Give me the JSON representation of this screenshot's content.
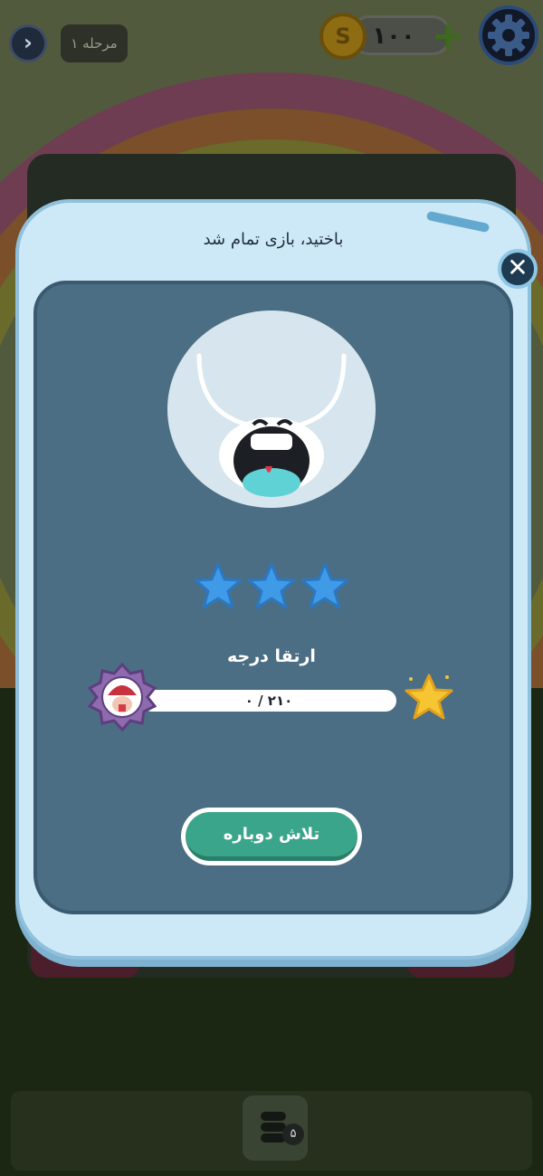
{
  "topbar": {
    "back_icon": "chevron-right-icon",
    "level_label": "مرحله ۱",
    "coins": "۱۰۰",
    "coin_icon": "coin-icon",
    "add_icon": "plus-icon",
    "settings_icon": "gear-icon"
  },
  "modal": {
    "title": "باختید، بازی تمام شد",
    "close_icon": "close-icon",
    "character": "crying-character",
    "stars_earned": 0,
    "stars_total": 3,
    "rank_title": "ارتقا درجه",
    "progress": {
      "text": "۰ / ۲۱۰",
      "current": 0,
      "max": 210
    },
    "retry_label": "تلاش دوباره"
  },
  "bottom": {
    "helper_icon": "stack-icon",
    "helper_count": "۵"
  },
  "colors": {
    "modal_frame": "#cde8f6",
    "modal_panel": "#4b6e84",
    "star_empty": "#3f9be8",
    "retry_button": "#3aa58a"
  }
}
